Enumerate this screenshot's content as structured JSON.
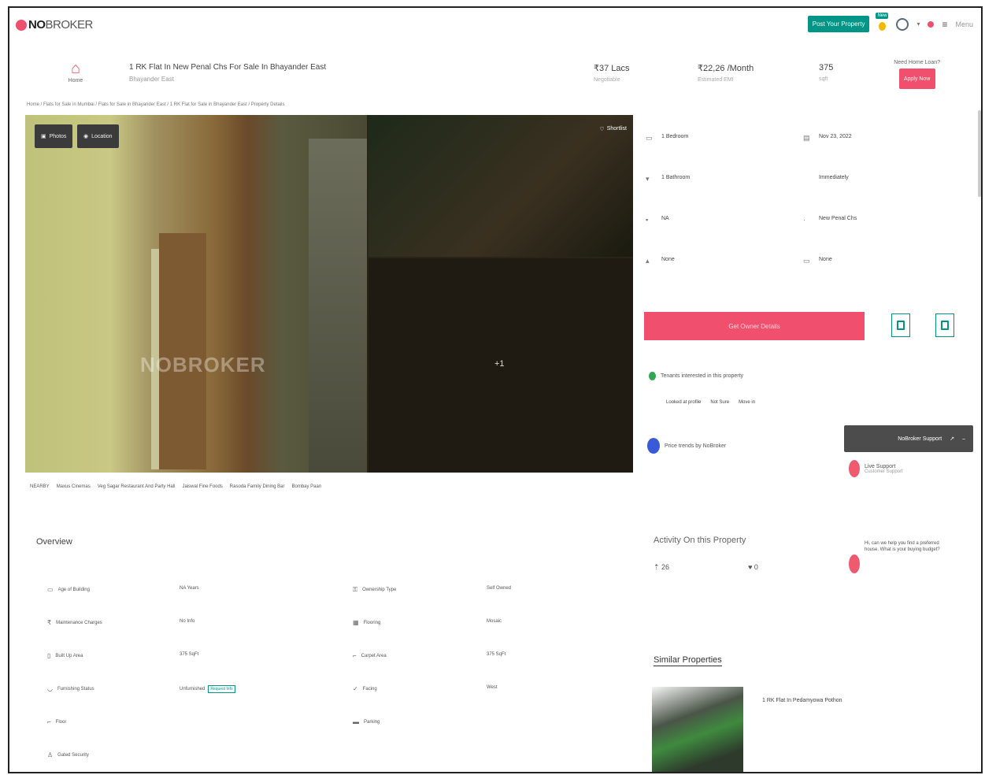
{
  "brand": {
    "no": "NO",
    "broker": "BROKER"
  },
  "topbar": {
    "links": [
      "",
      ""
    ],
    "post_property": "Post Your Property",
    "badge_new": "New",
    "menu_label": "Menu"
  },
  "header": {
    "home_label": "Home",
    "title": "1 RK Flat In New Penal Chs For Sale In Bhayander East",
    "subtitle": "Bhayander East",
    "price": "₹37 Lacs",
    "price_sub": "Negotiable",
    "emi": "₹22,26 /Month",
    "emi_sub": "Estimated EMI",
    "area": "375",
    "area_sub": "sqft",
    "contact_q": "Need Home Loan?",
    "contact_btn": "Apply Now"
  },
  "breadcrumb": "Home / Flats for Sale in Mumbai / Flats for Sale in Bhayander East / 1 RK Flat for Sale in Bhayander East / Property Details",
  "gallery": {
    "photos_label": "Photos",
    "location_label": "Location",
    "shortlist_label": "Shortlist",
    "more": "+1",
    "watermark": "NOBROKER"
  },
  "nearby": [
    "NEARBY",
    "Maxus Cinemas",
    "Veg Sagar Restaurant And Party Hall",
    "Jaiswal Fine Foods",
    "Rasoda Family Dining Bar",
    "Bombay Paan"
  ],
  "details": [
    {
      "title": "1 Bedroom",
      "sub": "",
      "icon": "bed-icon"
    },
    {
      "title": "Nov 23, 2022",
      "sub": "",
      "icon": "calendar-icon"
    },
    {
      "title": "1 Bathroom",
      "sub": "",
      "icon": "bath-icon"
    },
    {
      "title": "Immediately",
      "sub": "",
      "icon": "clock-icon"
    },
    {
      "title": "NA",
      "sub": "",
      "icon": "parking-icon"
    },
    {
      "title": "New Penal Chs",
      "sub": "",
      "icon": "building-icon"
    },
    {
      "title": "None",
      "sub": "",
      "icon": "balcony-icon"
    },
    {
      "title": "None",
      "sub": "",
      "icon": "furnish-icon"
    }
  ],
  "actions": {
    "get_owner": "Get Owner Details"
  },
  "tenant": {
    "question": "Tenants interested in this property",
    "options": [
      "Looked at profile",
      "Not Sure",
      "Move in"
    ]
  },
  "price_trends": "Price trends by NoBroker",
  "support": {
    "title": "NoBroker Support",
    "live": "Live Support",
    "live_sub": "Customer Support",
    "timestamp": "",
    "name": "",
    "message": "Hi, can we help you find a preferred house. What is your buying budget?"
  },
  "activity": {
    "title": "Activity On this Property",
    "views": "26",
    "shortlists": "0"
  },
  "overview": {
    "title": "Overview",
    "rows": [
      {
        "label": "Age of Building",
        "value": "NA Years",
        "icon": "building-icon"
      },
      {
        "label": "Ownership Type",
        "value": "Self Owned",
        "icon": "key-icon"
      },
      {
        "label": "Maintenance Charges",
        "value": "No Info",
        "icon": "rupee-icon"
      },
      {
        "label": "Flooring",
        "value": "Mosaic",
        "icon": "grid-icon"
      },
      {
        "label": "Built Up Area",
        "value": "375 SqFt",
        "icon": "ruler-icon"
      },
      {
        "label": "Carpet Area",
        "value": "375 SqFt",
        "icon": "area-icon"
      },
      {
        "label": "Furnishing Status",
        "value": "Unfurnished",
        "icon": "sofa-icon"
      },
      {
        "label": "Facing",
        "value": "West",
        "icon": "compass-icon"
      },
      {
        "label": "Floor",
        "value": "",
        "icon": "stairs-icon"
      },
      {
        "label": "Parking",
        "value": "",
        "icon": "car-icon"
      },
      {
        "label": "Gated Security",
        "value": "",
        "icon": "guard-icon"
      }
    ],
    "badge": "Request Info"
  },
  "similar": {
    "title": "Similar Properties",
    "item_title": "1 RK Flat In Pedamyowa Pothon",
    "item_sub": "",
    "item_offer": "",
    "item_price": "",
    "more": ""
  }
}
